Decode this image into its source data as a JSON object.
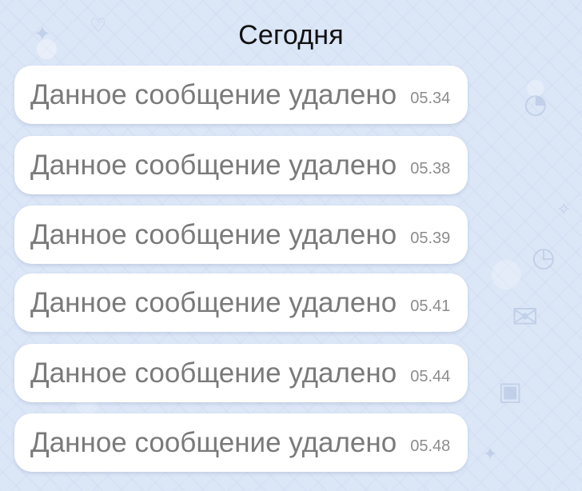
{
  "header": {
    "date_label": "Сегодня"
  },
  "messages": [
    {
      "text": "Данное сообщение удалено",
      "time": "05.34"
    },
    {
      "text": "Данное сообщение удалено",
      "time": "05.38"
    },
    {
      "text": "Данное сообщение удалено",
      "time": "05.39"
    },
    {
      "text": "Данное сообщение удалено",
      "time": "05.41"
    },
    {
      "text": "Данное сообщение удалено",
      "time": "05.44"
    },
    {
      "text": "Данное сообщение удалено",
      "time": "05.48"
    }
  ]
}
